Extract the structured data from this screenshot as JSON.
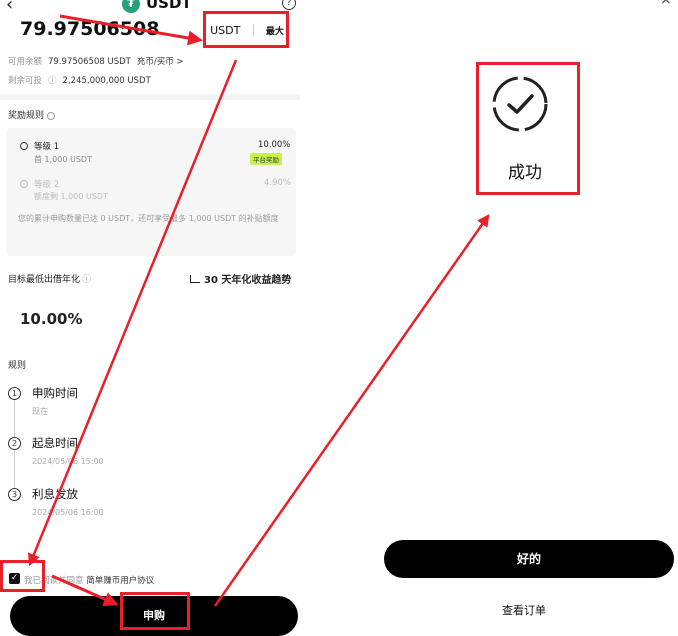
{
  "left": {
    "title": "USDT",
    "amount": "79.97506508",
    "unit": "USDT",
    "max_label": "最大",
    "available_label": "可用余额",
    "available_value": "79.97506508 USDT",
    "deposit_link": "充币/买币 >",
    "remaining_label": "剩余可投",
    "remaining_value": "2,245,000,000 USDT",
    "reward_rules_title": "奖励规则",
    "tiers": [
      {
        "name": "等级 1",
        "sub": "首 1,000 USDT",
        "rate": "10.00%",
        "badge": "平台奖励"
      },
      {
        "name": "等级 2",
        "sub": "额度剩 1,000 USDT",
        "rate": "4.90%"
      }
    ],
    "reward_note": "您的累计申购数量已达 0 USDT，还可享受最多 1,000 USDT 的补贴额度",
    "target_label": "目标最低出借年化",
    "trend_link": "30 天年化收益趋势",
    "rate_value": "10.00%",
    "rules_title": "规则",
    "steps": [
      {
        "num": "1",
        "title": "申购时间",
        "sub": "现在"
      },
      {
        "num": "2",
        "title": "起息时间",
        "sub": "2024/05/06 15:00"
      },
      {
        "num": "3",
        "title": "利息发放",
        "sub": "2024/05/06 16:00"
      }
    ],
    "agree_text": "我已阅读并同意",
    "agree_link": "简单赚币用户协议",
    "subscribe_button": "申购"
  },
  "right": {
    "success_text": "成功",
    "ok_button": "好的",
    "view_orders": "查看订单"
  },
  "colors": {
    "highlight": "#e8202a",
    "badge": "#c8f24a",
    "button": "#000000",
    "usdt": "#26a17b"
  }
}
